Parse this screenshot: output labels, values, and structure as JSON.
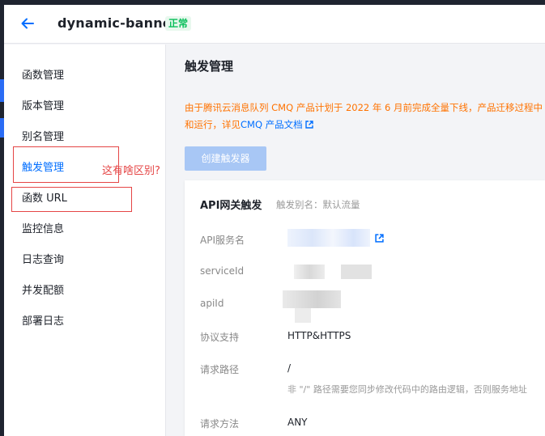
{
  "header": {
    "title": "dynamic-banner",
    "status": "正常"
  },
  "sidebar": {
    "items": [
      {
        "label": "函数管理"
      },
      {
        "label": "版本管理"
      },
      {
        "label": "别名管理"
      },
      {
        "label": "触发管理"
      },
      {
        "label": "函数 URL"
      },
      {
        "label": "监控信息"
      },
      {
        "label": "日志查询"
      },
      {
        "label": "并发配额"
      },
      {
        "label": "部署日志"
      }
    ],
    "active_index": 3
  },
  "annotation": {
    "note": "这有啥区别?"
  },
  "main": {
    "title": "触发管理",
    "notice_line1": "由于腾讯云消息队列 CMQ 产品计划于 2022 年 6 月前完成全量下线，产品迁移过程中",
    "notice_line2_prefix": "和运行，详见",
    "notice_link": "CMQ 产品文档",
    "create_button": "创建触发器"
  },
  "card": {
    "title": "API网关触发",
    "alias": "触发别名：默认流量",
    "fields": [
      {
        "label": "API服务名",
        "value": ""
      },
      {
        "label": "serviceId",
        "value": ""
      },
      {
        "label": "apiId",
        "value": ""
      },
      {
        "label": "协议支持",
        "value": "HTTP&HTTPS"
      },
      {
        "label": "请求路径",
        "value": "/"
      },
      {
        "label": "请求方法",
        "value": "ANY"
      }
    ],
    "path_hint": "非 \"/\" 路径需要您同步修改代码中的路由逻辑，否则服务地址"
  },
  "colors": {
    "primary": "#006eff",
    "warning": "#ff7200",
    "annotation": "#e54545",
    "success": "#0abf5b"
  }
}
